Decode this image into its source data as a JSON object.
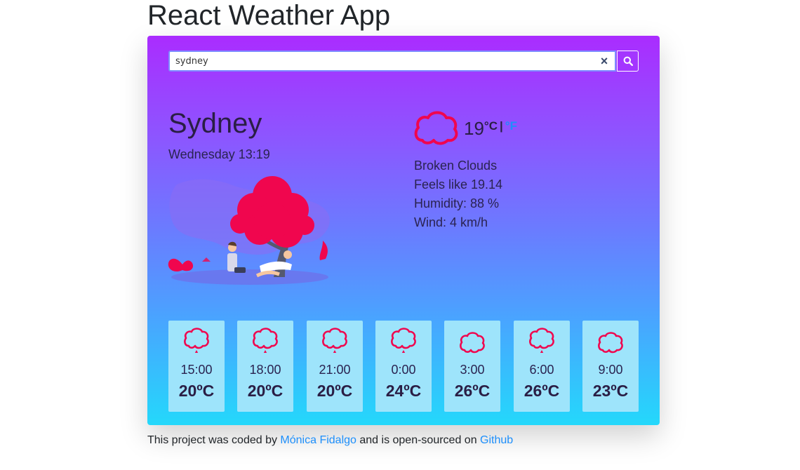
{
  "page_title": "React Weather App",
  "search": {
    "value": "sydney",
    "clear_label": "×"
  },
  "current": {
    "city": "Sydney",
    "datetime": "Wednesday 13:19",
    "temperature": "19",
    "unit_celsius": "°C",
    "unit_separator": "|",
    "unit_fahrenheit": "°F",
    "icon": "cloud-icon",
    "description": "Broken Clouds",
    "feels_like": "Feels like 19.14",
    "humidity": "Humidity: 88 %",
    "wind": "Wind: 4 km/h"
  },
  "forecast": [
    {
      "time": "15:00",
      "temp": "20ºC",
      "icon": "rain-cloud-icon"
    },
    {
      "time": "18:00",
      "temp": "20ºC",
      "icon": "rain-cloud-icon"
    },
    {
      "time": "21:00",
      "temp": "20ºC",
      "icon": "rain-cloud-icon"
    },
    {
      "time": "0:00",
      "temp": "24ºC",
      "icon": "rain-cloud-icon"
    },
    {
      "time": "3:00",
      "temp": "26ºC",
      "icon": "cloud-icon"
    },
    {
      "time": "6:00",
      "temp": "26ºC",
      "icon": "rain-cloud-icon"
    },
    {
      "time": "9:00",
      "temp": "23ºC",
      "icon": "cloud-icon"
    }
  ],
  "footer": {
    "prefix": "This project was coded by ",
    "author": "Mónica Fidalgo",
    "middle": " and is open-sourced on ",
    "repo": "Github"
  },
  "colors": {
    "accent": "#1d8ffb",
    "icon": "#f0064e",
    "gradient_top": "#aa2cff",
    "gradient_bottom": "#24d8fb",
    "forecast_card": "#9ee4fb"
  }
}
